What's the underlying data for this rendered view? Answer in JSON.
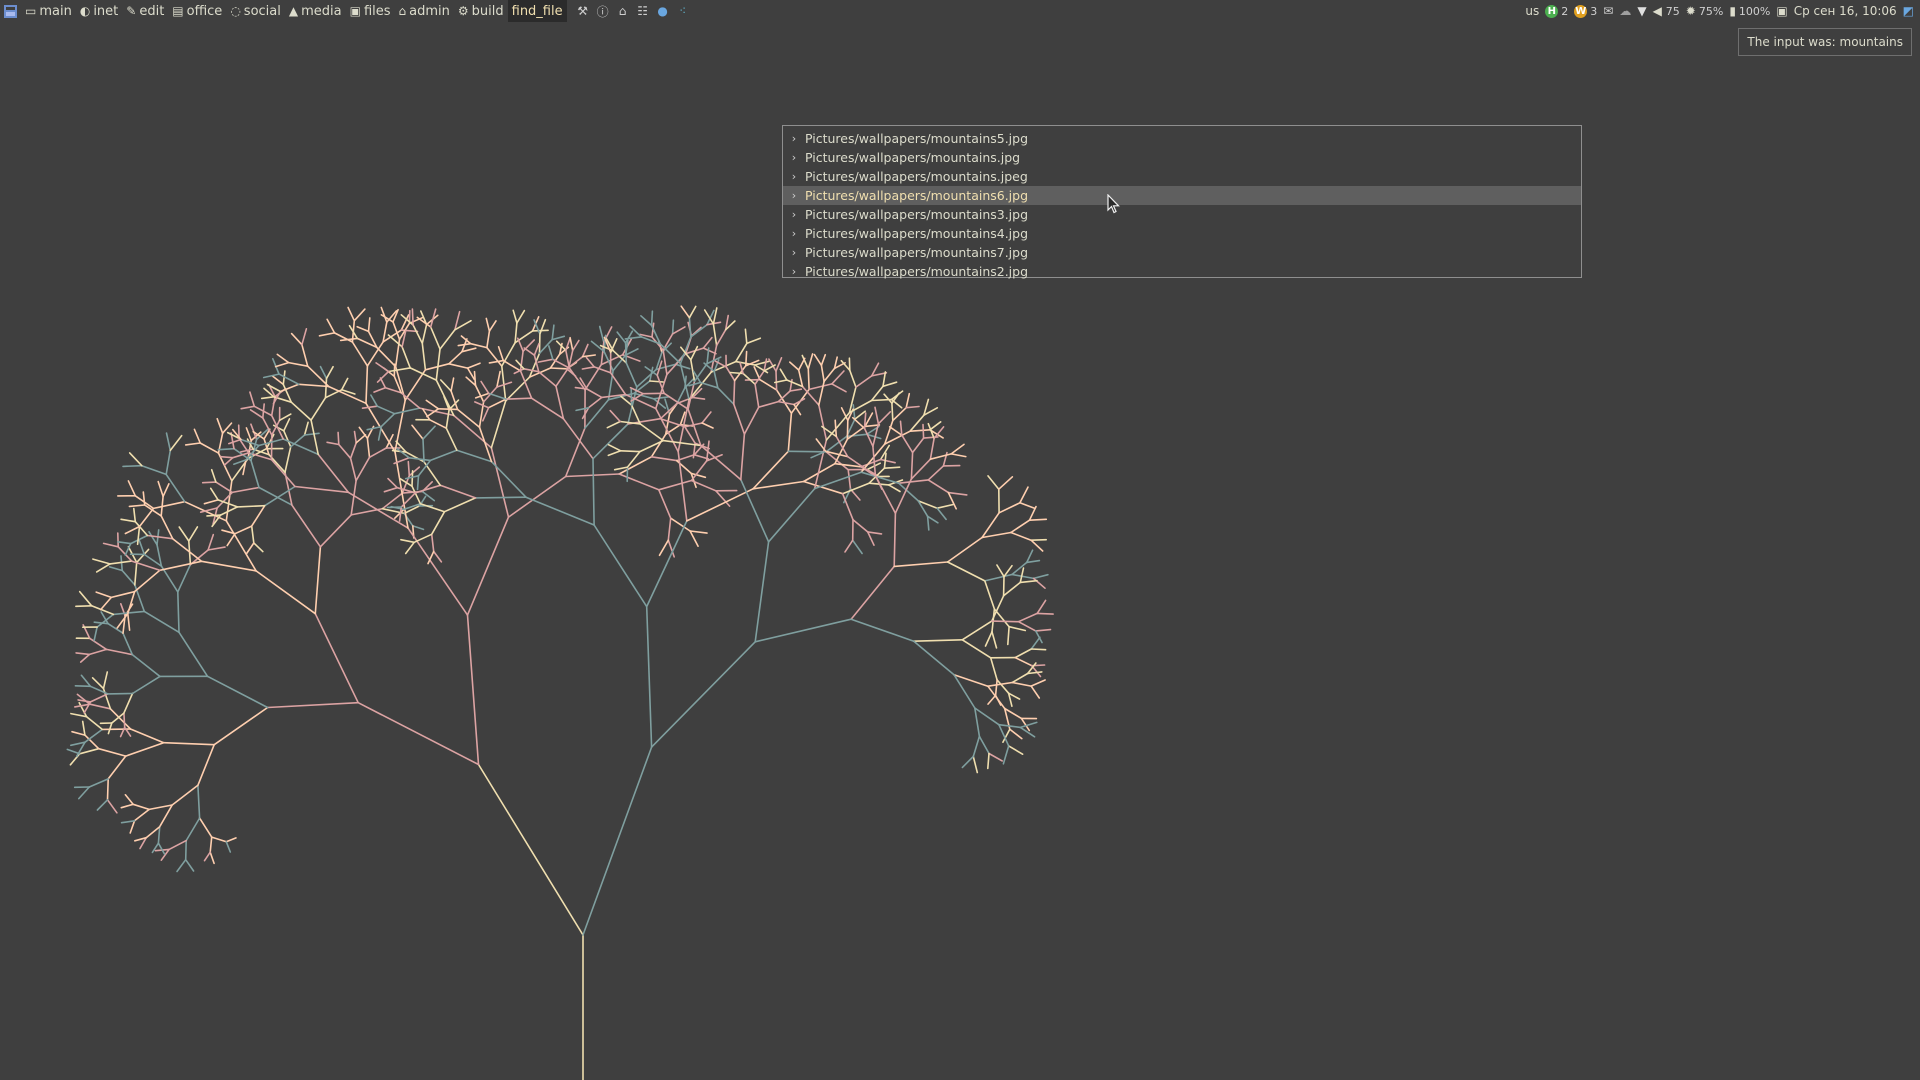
{
  "topbar": {
    "workspaces": [
      {
        "label": "main",
        "icon": "monitor-icon",
        "glyph": "▭"
      },
      {
        "label": "inet",
        "icon": "globe-icon",
        "glyph": "◐"
      },
      {
        "label": "edit",
        "icon": "pencil-icon",
        "glyph": "✎"
      },
      {
        "label": "office",
        "icon": "document-icon",
        "glyph": "▤"
      },
      {
        "label": "social",
        "icon": "chat-bubble-icon",
        "glyph": "◌"
      },
      {
        "label": "media",
        "icon": "chart-icon",
        "glyph": "▲"
      },
      {
        "label": "files",
        "icon": "archive-icon",
        "glyph": "▣"
      },
      {
        "label": "admin",
        "icon": "lock-icon",
        "glyph": "⌂"
      },
      {
        "label": "build",
        "icon": "cog-icon",
        "glyph": "⚙"
      },
      {
        "label": "find_file",
        "icon": "",
        "glyph": "",
        "active": true
      }
    ],
    "tools": [
      "wrench-icon",
      "info-icon",
      "home-icon",
      "grid-icon",
      "browser-icon",
      "apps-icon"
    ]
  },
  "tray": {
    "layout": "us",
    "updates_count": "2",
    "warnings_count": "3",
    "volume": "75",
    "brightness": "75%",
    "battery": "100%",
    "datetime": "Ср сен 16, 10:06"
  },
  "tooltip": {
    "text": "The input was: mountains"
  },
  "results": {
    "items": [
      "Pictures/wallpapers/mountains5.jpg",
      "Pictures/wallpapers/mountains.jpg",
      "Pictures/wallpapers/mountains.jpeg",
      "Pictures/wallpapers/mountains6.jpg",
      "Pictures/wallpapers/mountains3.jpg",
      "Pictures/wallpapers/mountains4.jpg",
      "Pictures/wallpapers/mountains7.jpg",
      "Pictures/wallpapers/mountains2.jpg"
    ],
    "selected_index": 3
  },
  "wallpaper": {
    "colors": [
      "#f0dfaf",
      "#dca3a3",
      "#7f9f9f",
      "#ffcfaf"
    ]
  }
}
